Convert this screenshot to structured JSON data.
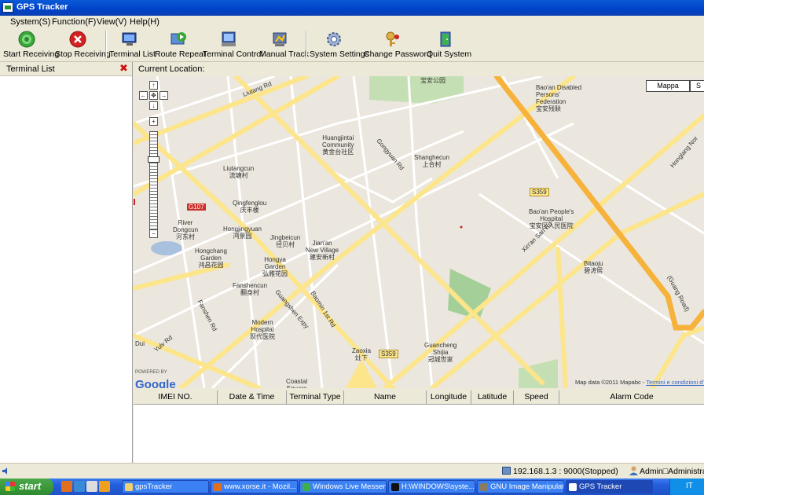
{
  "window": {
    "title": "GPS Tracker"
  },
  "menu": [
    "System(S)",
    "Function(F)",
    "View(V)",
    "Help(H)"
  ],
  "toolbar": [
    {
      "label": "Start Receiving",
      "icon": "start-receiving-icon"
    },
    {
      "label": "Stop Receiving",
      "icon": "stop-receiving-icon"
    },
    {
      "label": "Terminal List",
      "icon": "terminal-list-icon"
    },
    {
      "label": "Route Repeat",
      "icon": "route-repeat-icon"
    },
    {
      "label": "Terminal Control",
      "icon": "terminal-control-icon"
    },
    {
      "label": "Manual Track",
      "icon": "manual-track-icon"
    },
    {
      "label": "System Settings",
      "icon": "system-settings-icon"
    },
    {
      "label": "Change Password",
      "icon": "change-password-icon"
    },
    {
      "label": "Quit System",
      "icon": "quit-system-icon"
    }
  ],
  "left_panel": {
    "title": "Terminal List",
    "close": "✖"
  },
  "location": {
    "label": "Current Location:"
  },
  "map": {
    "map_type_buttons": [
      "Mappa",
      "S"
    ],
    "zoom": {
      "up": "↑",
      "left": "←",
      "center": "✥",
      "right": "→",
      "down": "↓",
      "plus": "+",
      "minus": "−"
    },
    "powered_by": "POWERED BY",
    "logo": "Google",
    "attribution": "Map data ©2011 Mapabc - ",
    "terms": "Termini e condizioni d'uso",
    "labels": {
      "baoan_park": "宝安公园",
      "disabled": "Bao'an Disabled\nPersons'\nFederation\n宝安残联",
      "liutang": "Liutang Rd",
      "huangjintai": "Huangjintai\nCommunity\n黄金台社区",
      "shanghecun": "Shanghecun\n上合村",
      "gongyuan": "Gongyuan Rd",
      "liutangcun": "Liutangcun\n流塘村",
      "qingfenglou": "Qingfenglou\n庆丰楼",
      "river_dongcun": "River\nDongcun\n河东村",
      "hongjingyuan": "Hongjingyuan\n鸿景园",
      "jingbeicun": "Jingbeicun\n径贝村",
      "jianan": "Jian'an\nNew Village\n建安新村",
      "hongchang": "Hongchang\nGarden\n鸿昌花园",
      "hongya": "Hongya\nGarden\n弘雅花园",
      "fanshencun": "Fanshencun\n翻身村",
      "baoan_hospital": "Bao'an People's\nHospital\n宝安区人民医院",
      "xinan": "Xin'an San Rd",
      "bitaoju": "Bitaoju\n碧涛居",
      "guangshen": "Guangshen Expy",
      "baomin": "Baomin 1st Rd",
      "fanshen_rd": "Fanshen Rd",
      "modern_hospital": "Modern\nHospital\n现代医院",
      "zaoxia": "Zaoxia\n灶下",
      "guancheng": "Guancheng\nShijia\n冠城世家",
      "hongiang": "Honglang Nor",
      "yulv": "Yulv Rd",
      "coastal": "Coastal\nSquare",
      "g107": "G107",
      "s359a": "S359",
      "s359b": "S359",
      "dui": "Dui",
      "gong": "(Guang Road)"
    }
  },
  "grid": {
    "columns": [
      "IMEI NO.",
      "Date & Time",
      "Terminal Type",
      "Name",
      "Longitude",
      "Latitude",
      "Speed",
      "Alarm Code"
    ]
  },
  "status": {
    "connection": "192.168.1.3 : 9000(Stopped)",
    "user": "Admin□Administrators"
  },
  "taskbar": {
    "start": "start",
    "tasks": [
      {
        "label": "gpsTracker"
      },
      {
        "label": "www.xorse.it - Mozil..."
      },
      {
        "label": "Windows Live Messen..."
      },
      {
        "label": "H:\\WINDOWS\\syste..."
      },
      {
        "label": "GNU Image Manipulat..."
      },
      {
        "label": "GPS Tracker"
      }
    ],
    "tray": "IT"
  }
}
